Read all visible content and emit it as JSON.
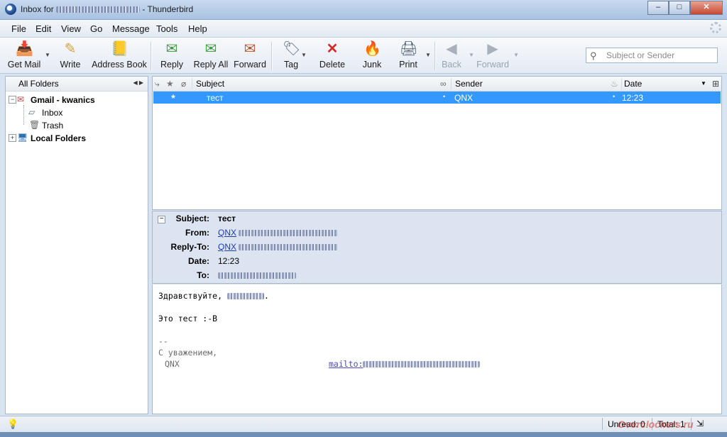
{
  "window": {
    "title_prefix": "Inbox for",
    "title_suffix": "- Thunderbird",
    "min": "–",
    "max": "□",
    "close": "✕"
  },
  "menu": [
    "File",
    "Edit",
    "View",
    "Go",
    "Message",
    "Tools",
    "Help"
  ],
  "toolbar": {
    "get_mail": "Get Mail",
    "write": "Write",
    "address_book": "Address Book",
    "reply": "Reply",
    "reply_all": "Reply All",
    "forward": "Forward",
    "tag": "Tag",
    "delete": "Delete",
    "junk": "Junk",
    "print": "Print",
    "back": "Back",
    "forward_nav": "Forward"
  },
  "search": {
    "placeholder": "Subject or Sender"
  },
  "folders": {
    "header": "All Folders",
    "account": "Gmail - kwanics",
    "inbox": "Inbox",
    "trash": "Trash",
    "local": "Local Folders"
  },
  "message_list": {
    "columns": {
      "subject": "Subject",
      "sender": "Sender",
      "date": "Date"
    },
    "rows": [
      {
        "subject": "тест",
        "sender": "QNX",
        "date": "12:23"
      }
    ]
  },
  "headers": {
    "subject_label": "Subject:",
    "subject": "тест",
    "from_label": "From:",
    "from": "QNX",
    "reply_to_label": "Reply-To:",
    "reply_to": "QNX",
    "date_label": "Date:",
    "date": "12:23",
    "to_label": "To:"
  },
  "body": {
    "greeting": "Здравствуйте,",
    "line2": "Это тест :-B",
    "dashes": "--",
    "regards": "С уважением,",
    "sig_name": "QNX",
    "mailto": "mailto:"
  },
  "status": {
    "unread": "Unread: 0",
    "total": "Total: 1"
  },
  "watermark": "Overclockers.ru",
  "colors": {
    "selection": "#3399ff",
    "header_bg": "#dce4f1",
    "link": "#1c3bb3"
  }
}
